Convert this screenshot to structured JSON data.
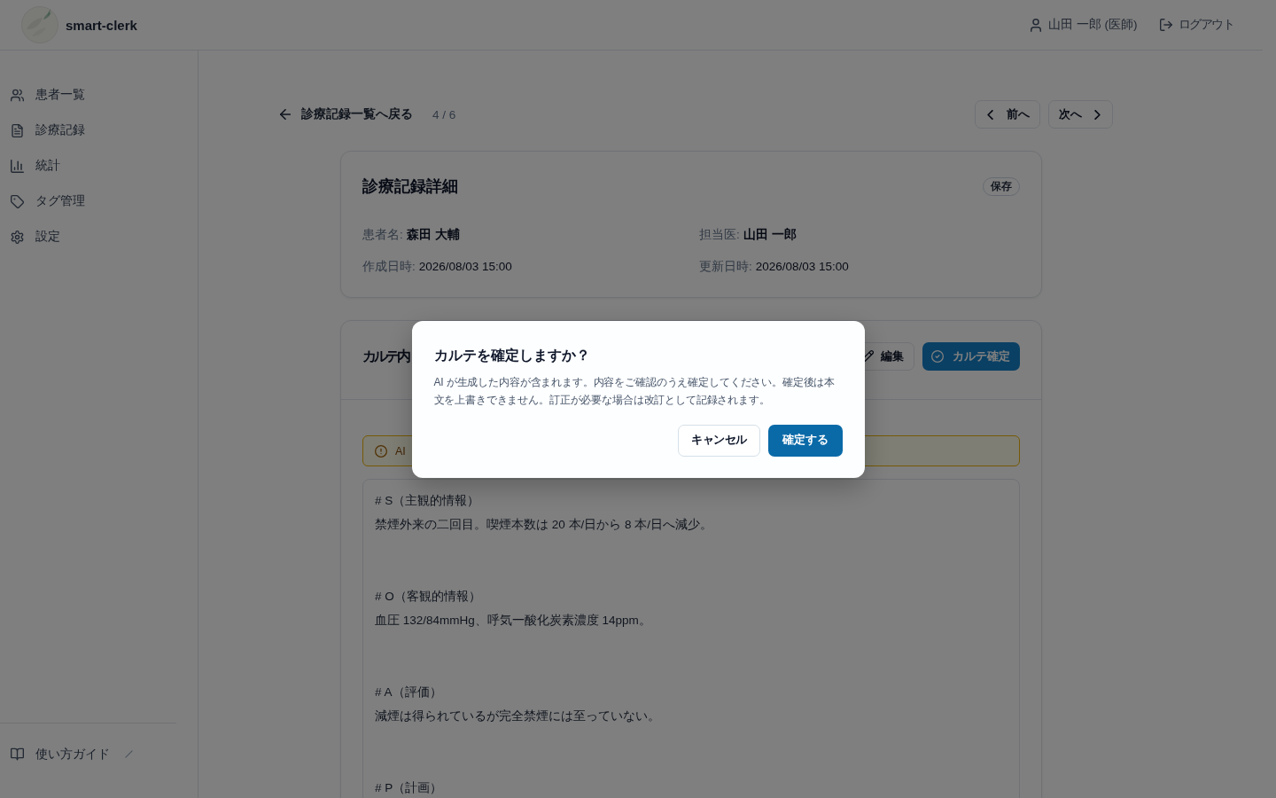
{
  "app": {
    "name": "smart-clerk"
  },
  "header": {
    "user": "山田 一郎 (医師)",
    "logout": "ログアウト"
  },
  "sidebar": {
    "items": [
      {
        "label": "患者一覧"
      },
      {
        "label": "診療記録"
      },
      {
        "label": "統計"
      },
      {
        "label": "タグ管理"
      },
      {
        "label": "設定"
      }
    ],
    "footer": {
      "label": "使い方ガイド"
    }
  },
  "toolbar": {
    "back": "診療記録一覧へ戻る",
    "position": "4 / 6",
    "prev": "前へ",
    "next": "次へ"
  },
  "record": {
    "title": "診療記録詳細",
    "badge": "保存",
    "fields": [
      {
        "label": "患者名:",
        "value": "森田 大輔",
        "kind": "person"
      },
      {
        "label": "担当医:",
        "value": "山田 一郎",
        "kind": "person"
      },
      {
        "label": "作成日時:",
        "value": "2026/08/03 15:00",
        "kind": "timestamp"
      },
      {
        "label": "更新日時:",
        "value": "2026/08/03 15:00",
        "kind": "timestamp"
      }
    ]
  },
  "chart": {
    "title": "カルテ内",
    "edit": "編集",
    "confirm": "カルテ確定",
    "notice": "AI",
    "sections": [
      {
        "heading": "# S（主観的情報）",
        "text": "禁煙外来の二回目。喫煙本数は 20 本/日から 8 本/日へ減少。"
      },
      {
        "heading": "# O（客観的情報）",
        "text": "血圧 132/84mmHg、呼気一酸化炭素濃度 14ppm。"
      },
      {
        "heading": "# A（評価）",
        "text": "減煙は得られているが完全禁煙には至っていない。"
      },
      {
        "heading": "# P（計画）"
      }
    ]
  },
  "dialog": {
    "title": "カルテを確定しますか？",
    "message": "AI が生成した内容が含まれます。内容をご確認のうえ確定してください。確定後は本文を上書きできません。訂正が必要な場合は改訂として記録されます。",
    "cancel": "キャンセル",
    "confirm": "確定する"
  }
}
